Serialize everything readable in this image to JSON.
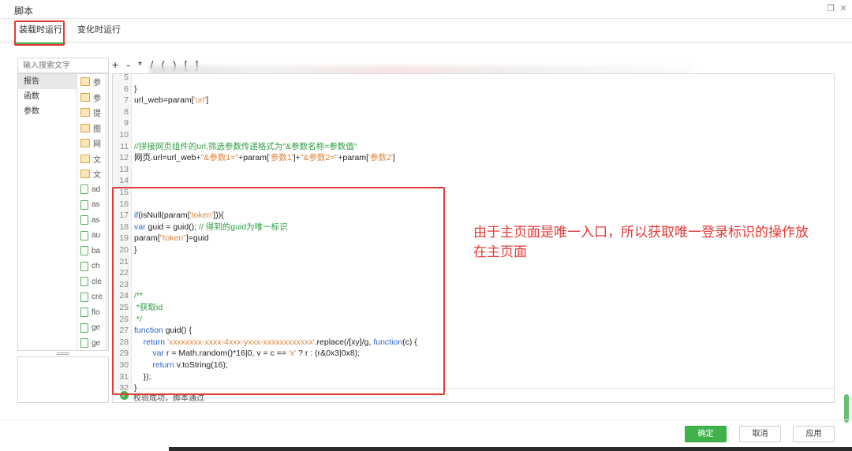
{
  "window": {
    "title": "脚本",
    "restore_icon": "restore-icon",
    "close_icon": "close-icon"
  },
  "tabs": [
    {
      "label": "装载时运行",
      "active": true
    },
    {
      "label": "变化时运行",
      "active": false
    }
  ],
  "search": {
    "placeholder": "输入搜索文字"
  },
  "categories": [
    "报告",
    "函数",
    "参数"
  ],
  "files": [
    {
      "label": "参",
      "type": "folder"
    },
    {
      "label": "参",
      "type": "folder"
    },
    {
      "label": "提",
      "type": "folder"
    },
    {
      "label": "图",
      "type": "folder"
    },
    {
      "label": "网",
      "type": "folder"
    },
    {
      "label": "文",
      "type": "folder"
    },
    {
      "label": "文",
      "type": "folder"
    },
    {
      "label": "ad",
      "type": "file"
    },
    {
      "label": "as",
      "type": "file"
    },
    {
      "label": "as",
      "type": "file"
    },
    {
      "label": "au",
      "type": "file"
    },
    {
      "label": "ba",
      "type": "file"
    },
    {
      "label": "ch",
      "type": "file"
    },
    {
      "label": "cle",
      "type": "file"
    },
    {
      "label": "cre",
      "type": "file"
    },
    {
      "label": "flo",
      "type": "file"
    },
    {
      "label": "ge",
      "type": "file"
    },
    {
      "label": "ge",
      "type": "file"
    }
  ],
  "toolbar": {
    "items": [
      "+",
      "-",
      "*",
      "/",
      "(",
      ")",
      "[",
      "]"
    ]
  },
  "code_lines": [
    {
      "n": "5",
      "parts": []
    },
    {
      "n": "6",
      "parts": [
        {
          "t": "}",
          "c": "plain"
        }
      ]
    },
    {
      "n": "7",
      "parts": [
        {
          "t": "url_web=param[",
          "c": "plain"
        },
        {
          "t": "'url'",
          "c": "string"
        },
        {
          "t": "]",
          "c": "plain"
        }
      ]
    },
    {
      "n": "8",
      "parts": []
    },
    {
      "n": "9",
      "parts": []
    },
    {
      "n": "10",
      "parts": []
    },
    {
      "n": "11",
      "parts": [
        {
          "t": "//拼接网页组件的url,筛选参数传递格式为\"&参数名称=参数值\"",
          "c": "comment"
        }
      ]
    },
    {
      "n": "12",
      "parts": [
        {
          "t": "网页.url=url_web+",
          "c": "plain"
        },
        {
          "t": "\"&参数1=\"",
          "c": "string"
        },
        {
          "t": "+param[",
          "c": "plain"
        },
        {
          "t": "'参数1'",
          "c": "string"
        },
        {
          "t": "]+",
          "c": "plain"
        },
        {
          "t": "\"&参数2=\"",
          "c": "string"
        },
        {
          "t": "+param[",
          "c": "plain"
        },
        {
          "t": "'参数2'",
          "c": "string"
        },
        {
          "t": "]",
          "c": "plain"
        }
      ]
    },
    {
      "n": "13",
      "parts": []
    },
    {
      "n": "14",
      "parts": []
    },
    {
      "n": "15",
      "parts": []
    },
    {
      "n": "16",
      "parts": []
    },
    {
      "n": "17",
      "parts": [
        {
          "t": "if",
          "c": "keyword"
        },
        {
          "t": "(isNull(param[",
          "c": "plain"
        },
        {
          "t": "'token'",
          "c": "string"
        },
        {
          "t": "])){",
          "c": "plain"
        }
      ]
    },
    {
      "n": "18",
      "parts": [
        {
          "t": "var",
          "c": "keyword"
        },
        {
          "t": " guid = guid(); ",
          "c": "plain"
        },
        {
          "t": "// 得到的guid为唯一标识",
          "c": "comment"
        }
      ]
    },
    {
      "n": "19",
      "parts": [
        {
          "t": "param[",
          "c": "plain"
        },
        {
          "t": "\"token\"",
          "c": "string"
        },
        {
          "t": "]=guid",
          "c": "plain"
        }
      ]
    },
    {
      "n": "20",
      "parts": [
        {
          "t": "}",
          "c": "plain"
        }
      ]
    },
    {
      "n": "21",
      "parts": []
    },
    {
      "n": "22",
      "parts": []
    },
    {
      "n": "23",
      "parts": []
    },
    {
      "n": "24",
      "parts": [
        {
          "t": "/**",
          "c": "comment"
        }
      ]
    },
    {
      "n": "25",
      "parts": [
        {
          "t": " *获取id",
          "c": "comment"
        }
      ]
    },
    {
      "n": "26",
      "parts": [
        {
          "t": " */",
          "c": "comment"
        }
      ]
    },
    {
      "n": "27",
      "parts": [
        {
          "t": "function",
          "c": "keyword"
        },
        {
          "t": " guid() {",
          "c": "plain"
        }
      ]
    },
    {
      "n": "28",
      "parts": [
        {
          "t": "    ",
          "c": "plain"
        },
        {
          "t": "return",
          "c": "keyword"
        },
        {
          "t": " ",
          "c": "plain"
        },
        {
          "t": "'xxxxxxxx-xxxx-4xxx-yxxx-xxxxxxxxxxxx'",
          "c": "string"
        },
        {
          "t": ".replace(/[xy]/g, ",
          "c": "plain"
        },
        {
          "t": "function",
          "c": "keyword"
        },
        {
          "t": "(c) {",
          "c": "plain"
        }
      ]
    },
    {
      "n": "29",
      "parts": [
        {
          "t": "        ",
          "c": "plain"
        },
        {
          "t": "var",
          "c": "keyword"
        },
        {
          "t": " r = Math.random()*16|0, v = c == ",
          "c": "plain"
        },
        {
          "t": "'x'",
          "c": "string"
        },
        {
          "t": " ? r : (r&0x3|0x8);",
          "c": "plain"
        }
      ]
    },
    {
      "n": "30",
      "parts": [
        {
          "t": "        ",
          "c": "plain"
        },
        {
          "t": "return",
          "c": "keyword"
        },
        {
          "t": " v.toString(16);",
          "c": "plain"
        }
      ]
    },
    {
      "n": "31",
      "parts": [
        {
          "t": "    });",
          "c": "plain"
        }
      ]
    },
    {
      "n": "32",
      "parts": [
        {
          "t": "}",
          "c": "plain"
        }
      ]
    }
  ],
  "status": {
    "text": "校验成功，脚本通过",
    "icon": "check-circle-icon"
  },
  "annotation": {
    "text": "由于主页面是唯一入口，所以获取唯一登录标识的操作放在主页面",
    "color": "#e53935"
  },
  "buttons": {
    "ok": "确定",
    "cancel": "取消",
    "apply": "应用"
  },
  "colors": {
    "accent": "#3fb24a",
    "highlight": "#e53935"
  }
}
